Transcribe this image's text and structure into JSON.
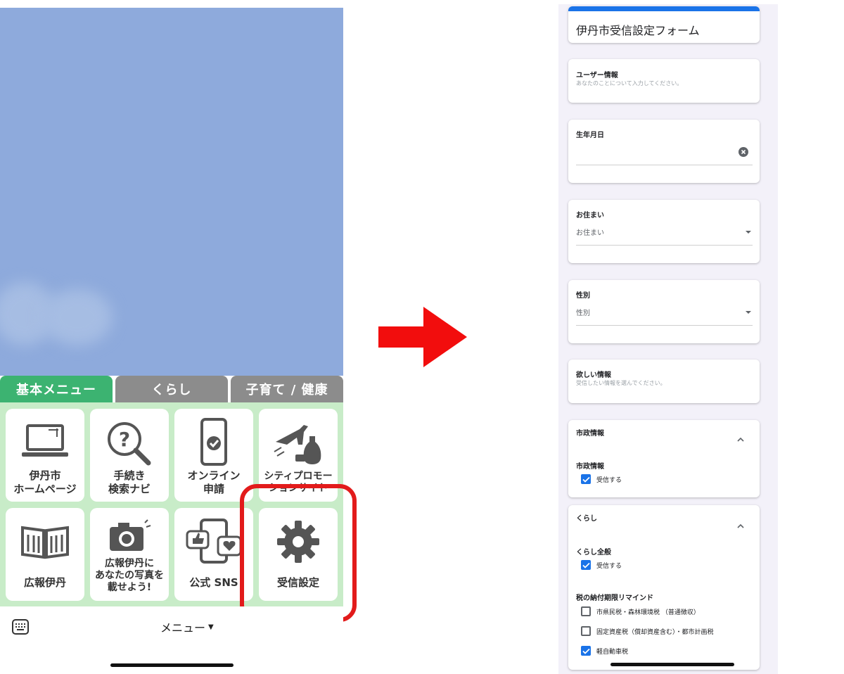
{
  "left": {
    "tabs": [
      "基本メニュー",
      "くらし",
      "子育て / 健康"
    ],
    "tiles": [
      {
        "label": "伊丹市\nホームページ",
        "icon": "laptop-icon"
      },
      {
        "label": "手続き\n検索ナビ",
        "icon": "magnifier-question-icon"
      },
      {
        "label": "オンライン\n申請",
        "icon": "smartphone-check-icon"
      },
      {
        "label": "シティプロモー\nションサイト",
        "icon": "airplane-sake-icon"
      },
      {
        "label": "広報伊丹",
        "icon": "open-book-icon"
      },
      {
        "label": "広報伊丹に\nあなたの写真を\n載せよう!",
        "icon": "camera-icon"
      },
      {
        "label": "公式 SNS",
        "icon": "sns-like-heart-icon"
      },
      {
        "label": "受信設定",
        "icon": "gear-icon"
      }
    ],
    "bottom_menu": "メニュー",
    "caret": "▼",
    "colors": {
      "chat_bg": "#8eaadc",
      "active_tab": "#3cb371",
      "inactive_tab": "#8c8c8c",
      "grid_bg": "#c8ecc8",
      "highlight": "#e21b1b"
    }
  },
  "right": {
    "form_title": "伊丹市受信設定フォーム",
    "user_info": {
      "heading": "ユーザー情報",
      "sub": "あなたのことについて入力してください。"
    },
    "birthday": {
      "label": "生年月日"
    },
    "residence": {
      "label": "お住まい",
      "value": "お住まい"
    },
    "gender": {
      "label": "性別",
      "value": "性別"
    },
    "wanted_info": {
      "heading": "欲しい情報",
      "sub": "受信したい情報を選んでください。"
    },
    "city_section": {
      "heading": "市政情報",
      "group": "市政情報",
      "option": "受信する",
      "checked": true
    },
    "life_section": {
      "heading": "くらし",
      "group1": "くらし全般",
      "group1_option": "受信する",
      "group2": "税の納付期限リマインド",
      "tax_options": [
        {
          "label": "市県民税・森林環境税 （普通徴収）",
          "checked": false
        },
        {
          "label": "固定資産税（償却資産含む）・都市計画税",
          "checked": false
        },
        {
          "label": "軽自動車税",
          "checked": true
        }
      ]
    },
    "colors": {
      "accent": "#1a73e8",
      "form_bg": "#f3f1f9"
    }
  }
}
